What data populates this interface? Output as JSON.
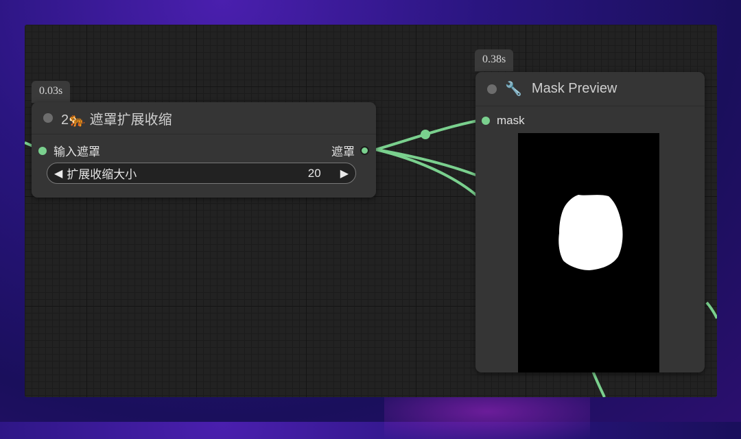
{
  "colors": {
    "wire": "#7ad08e",
    "node_bg": "#353535",
    "canvas_bg": "#222222"
  },
  "nodes": {
    "mask_expand": {
      "timing": "0.03s",
      "title": "2🐅 遮罩扩展收缩",
      "input_label": "输入遮罩",
      "output_label": "遮罩",
      "widget": {
        "label": "扩展收缩大小",
        "value": "20",
        "left_arrow": "◀",
        "right_arrow": "▶"
      }
    },
    "mask_preview": {
      "timing": "0.38s",
      "title": "Mask Preview",
      "title_icon": "wrench-icon",
      "input_label": "mask"
    }
  }
}
